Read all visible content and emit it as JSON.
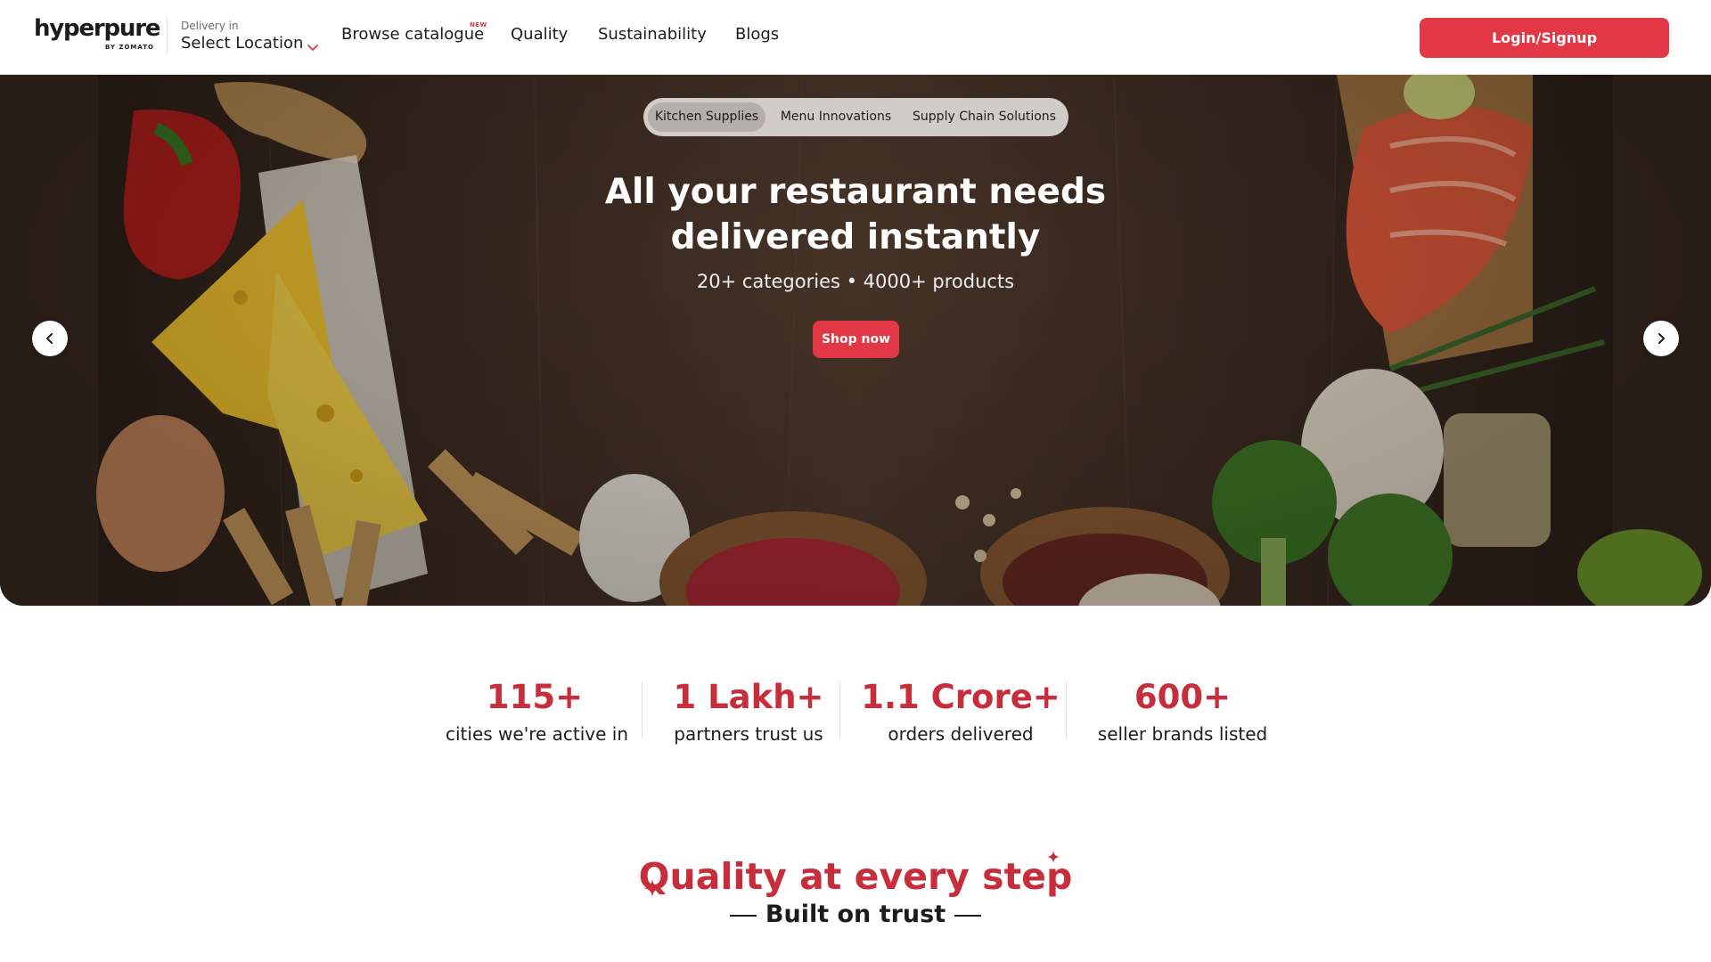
{
  "header": {
    "logo_text": "hyperpure",
    "logo_sub": "BY ZOMATO",
    "delivery_label": "Delivery in",
    "location_value": "Select Location",
    "nav": {
      "browse": "Browse catalogue",
      "browse_badge": "NEW",
      "quality": "Quality",
      "sustainability": "Sustainability",
      "blogs": "Blogs"
    },
    "login_label": "Login/Signup"
  },
  "hero": {
    "tabs": [
      "Kitchen Supplies",
      "Menu Innovations",
      "Supply Chain Solutions"
    ],
    "active_tab": "Kitchen Supplies",
    "title_line1": "All your restaurant needs",
    "title_line2": "delivered instantly",
    "subtitle": "20+ categories • 4000+ products",
    "cta": "Shop now"
  },
  "stats": [
    {
      "value": "115+",
      "label": "cities we're active in"
    },
    {
      "value": "1 Lakh+",
      "label": "partners trust us"
    },
    {
      "value": "1.1 Crore+",
      "label": "orders delivered"
    },
    {
      "value": "600+",
      "label": "seller brands listed"
    }
  ],
  "quality": {
    "title": "Quality at every step",
    "subtitle": "Built on trust"
  },
  "colors": {
    "brand_red": "#e23744",
    "stat_red": "#c72d3b",
    "hero_bg": "#3f2d22"
  },
  "icons": [
    "chevron-down-icon",
    "chevron-left-icon",
    "chevron-right-icon",
    "sparkle-icon"
  ]
}
